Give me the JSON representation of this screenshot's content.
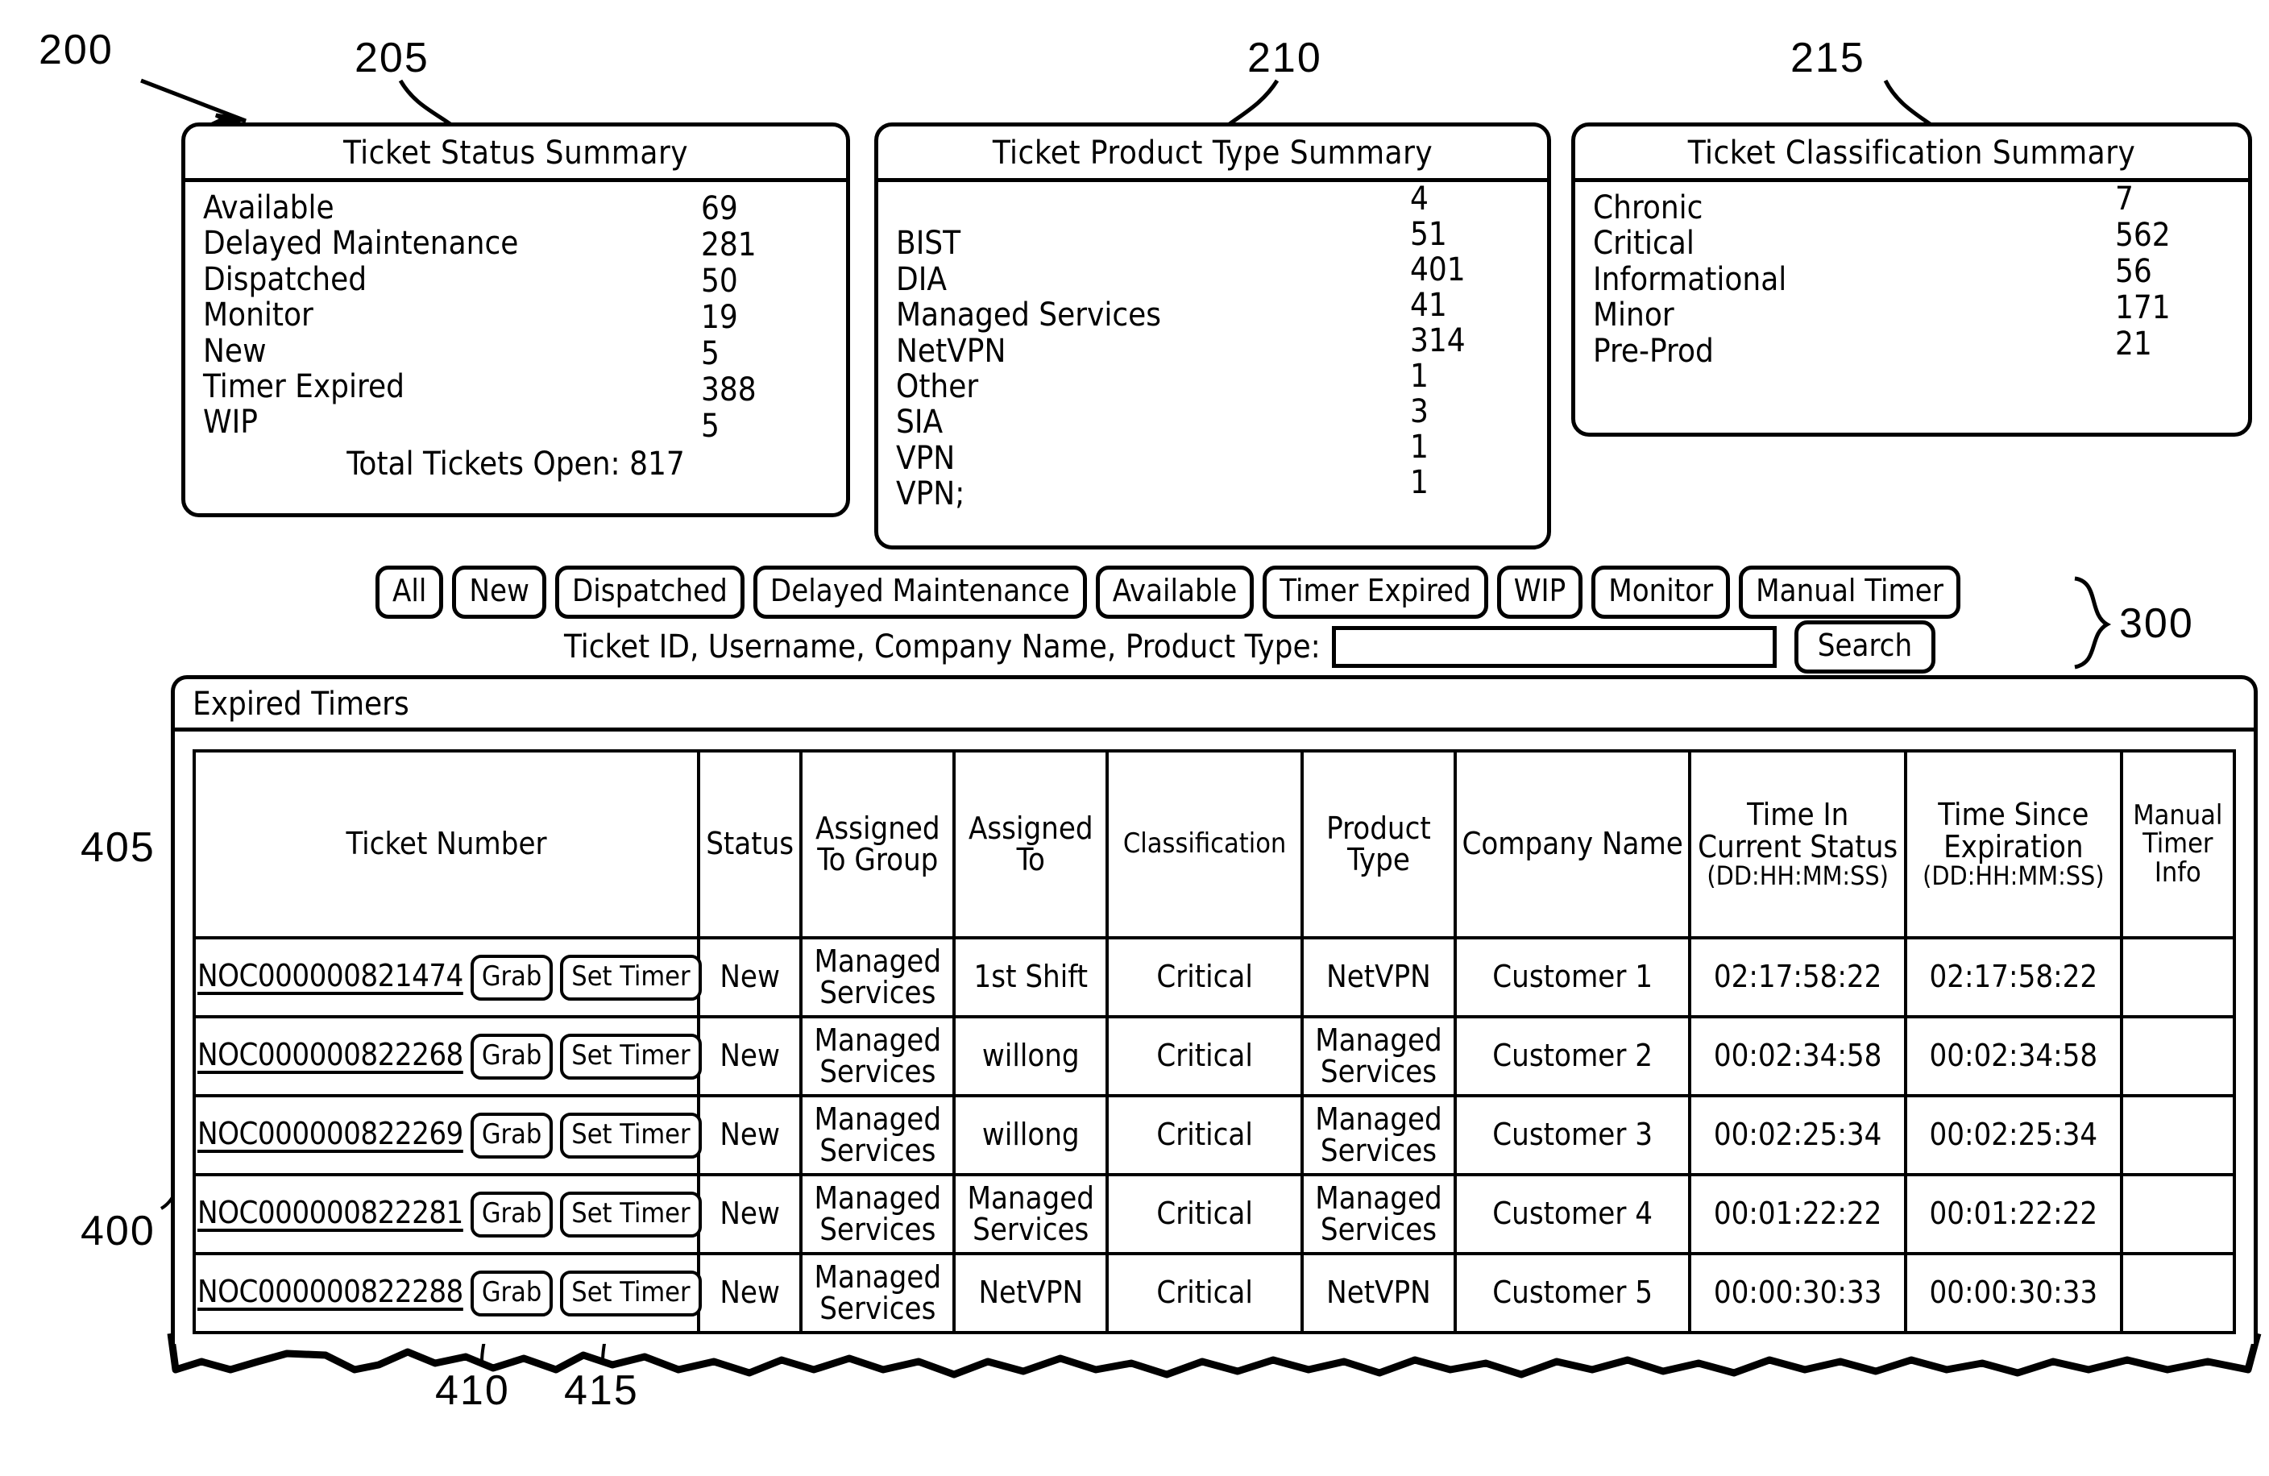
{
  "figure": {
    "refs": [
      {
        "id": "ref-200",
        "label": "200"
      },
      {
        "id": "ref-205",
        "label": "205"
      },
      {
        "id": "ref-210",
        "label": "210"
      },
      {
        "id": "ref-215",
        "label": "215"
      },
      {
        "id": "ref-300",
        "label": "300"
      },
      {
        "id": "ref-400",
        "label": "400"
      },
      {
        "id": "ref-405",
        "label": "405"
      },
      {
        "id": "ref-410",
        "label": "410"
      },
      {
        "id": "ref-415",
        "label": "415"
      }
    ]
  },
  "status_summary": {
    "title": "Ticket Status Summary",
    "rows": [
      {
        "label": "Available",
        "value": "69"
      },
      {
        "label": "Delayed Maintenance",
        "value": "281"
      },
      {
        "label": "Dispatched",
        "value": "50"
      },
      {
        "label": "Monitor",
        "value": "19"
      },
      {
        "label": "New",
        "value": "5"
      },
      {
        "label": "Timer Expired",
        "value": "388"
      },
      {
        "label": "WIP",
        "value": "5"
      }
    ],
    "total": "Total Tickets Open: 817"
  },
  "product_type_summary": {
    "title": "Ticket Product Type Summary",
    "rows": [
      {
        "label": "",
        "value": "4"
      },
      {
        "label": "BIST",
        "value": "51"
      },
      {
        "label": "DIA",
        "value": "401"
      },
      {
        "label": "Managed Services",
        "value": "41"
      },
      {
        "label": "NetVPN",
        "value": "314"
      },
      {
        "label": "Other",
        "value": "1"
      },
      {
        "label": "SIA",
        "value": "3"
      },
      {
        "label": "VPN",
        "value": "1"
      },
      {
        "label": "VPN;",
        "value": "1"
      }
    ]
  },
  "classification_summary": {
    "title": "Ticket Classification Summary",
    "rows": [
      {
        "label": "Chronic",
        "value": "7"
      },
      {
        "label": "Critical",
        "value": "562"
      },
      {
        "label": "Informational",
        "value": "56"
      },
      {
        "label": "Minor",
        "value": "171"
      },
      {
        "label": "Pre-Prod",
        "value": "21"
      }
    ]
  },
  "filter_bar": {
    "buttons": [
      {
        "label": "All"
      },
      {
        "label": "New"
      },
      {
        "label": "Dispatched"
      },
      {
        "label": "Delayed Maintenance"
      },
      {
        "label": "Available"
      },
      {
        "label": "Timer Expired"
      },
      {
        "label": "WIP"
      },
      {
        "label": "Monitor"
      },
      {
        "label": "Manual Timer"
      }
    ],
    "search_label": "Ticket ID, Username, Company Name, Product Type:",
    "search_value": "",
    "search_placeholder": "",
    "search_button": "Search"
  },
  "results": {
    "title": "Expired Timers",
    "columns": [
      "Ticket Number",
      "Status",
      "Assigned To Group",
      "Assigned To",
      "Classification",
      "Product Type",
      "Company Name",
      "Time In Current Status",
      "Time Since Expiration",
      "Manual Timer Info"
    ],
    "column_notes": {
      "time_in_current_status_format": "(DD:HH:MM:SS)",
      "time_since_expiration_format": "(DD:HH:MM:SS)"
    },
    "row_actions": {
      "grab": "Grab",
      "set_timer": "Set Timer"
    },
    "rows": [
      {
        "ticket_number": "NOC000000821474",
        "status": "New",
        "assigned_to_group": "Managed Services",
        "assigned_to": "1st Shift",
        "classification": "Critical",
        "product_type": "NetVPN",
        "company_name": "Customer 1",
        "time_in_current_status": "02:17:58:22",
        "time_since_expiration": "02:17:58:22",
        "manual_timer_info": ""
      },
      {
        "ticket_number": "NOC000000822268",
        "status": "New",
        "assigned_to_group": "Managed Services",
        "assigned_to": "willong",
        "classification": "Critical",
        "product_type": "Managed Services",
        "company_name": "Customer 2",
        "time_in_current_status": "00:02:34:58",
        "time_since_expiration": "00:02:34:58",
        "manual_timer_info": ""
      },
      {
        "ticket_number": "NOC000000822269",
        "status": "New",
        "assigned_to_group": "Managed Services",
        "assigned_to": "willong",
        "classification": "Critical",
        "product_type": "Managed Services",
        "company_name": "Customer 3",
        "time_in_current_status": "00:02:25:34",
        "time_since_expiration": "00:02:25:34",
        "manual_timer_info": ""
      },
      {
        "ticket_number": "NOC000000822281",
        "status": "New",
        "assigned_to_group": "Managed Services",
        "assigned_to": "Managed Services",
        "classification": "Critical",
        "product_type": "Managed Services",
        "company_name": "Customer 4",
        "time_in_current_status": "00:01:22:22",
        "time_since_expiration": "00:01:22:22",
        "manual_timer_info": ""
      },
      {
        "ticket_number": "NOC000000822288",
        "status": "New",
        "assigned_to_group": "Managed Services",
        "assigned_to": "NetVPN",
        "classification": "Critical",
        "product_type": "NetVPN",
        "company_name": "Customer 5",
        "time_in_current_status": "00:00:30:33",
        "time_since_expiration": "00:00:30:33",
        "manual_timer_info": ""
      }
    ]
  }
}
